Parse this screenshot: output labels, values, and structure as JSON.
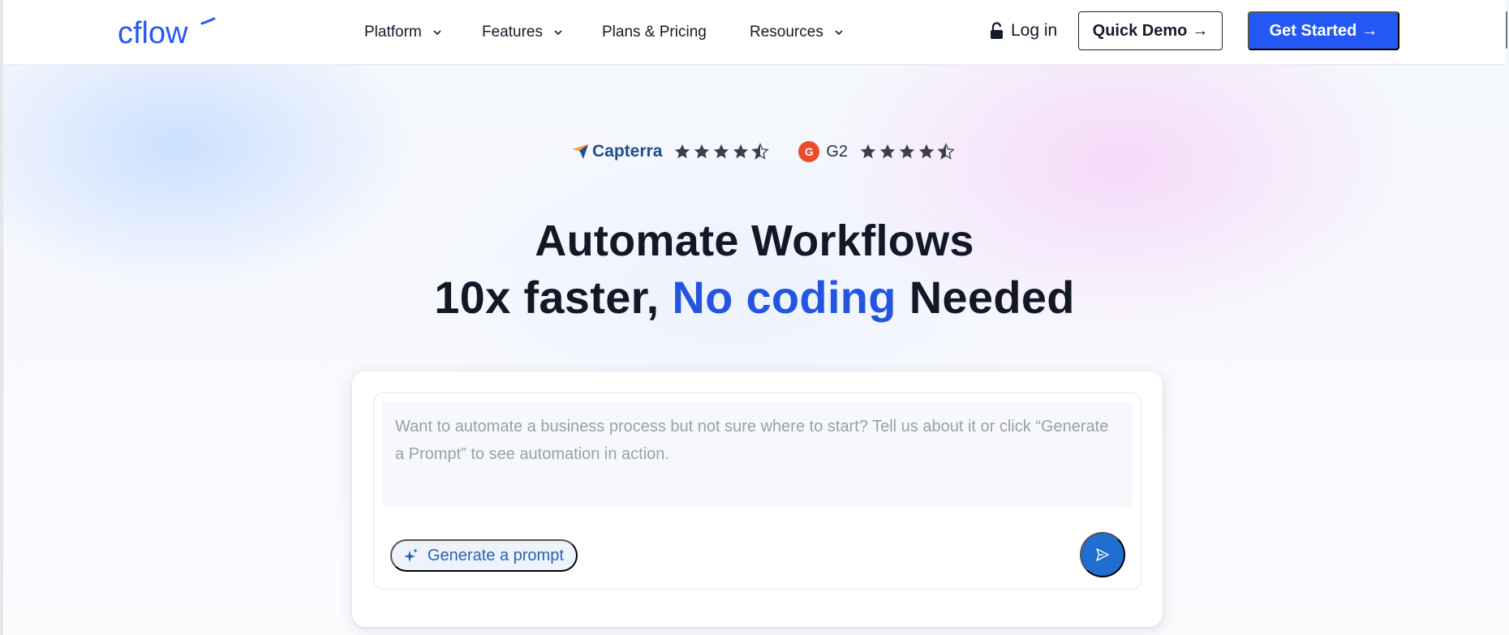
{
  "brand": {
    "logo_text": "cflow"
  },
  "nav": {
    "items": [
      {
        "label": "Platform",
        "has_dropdown": true
      },
      {
        "label": "Features",
        "has_dropdown": true
      },
      {
        "label": "Plans & Pricing",
        "has_dropdown": false
      },
      {
        "label": "Resources",
        "has_dropdown": true
      }
    ],
    "login_label": "Log in",
    "demo_label": "Quick Demo",
    "start_label": "Get Started",
    "arrow": "→"
  },
  "ratings": [
    {
      "source": "Capterra",
      "stars": 4.5
    },
    {
      "source": "G2",
      "stars": 4.5
    }
  ],
  "hero": {
    "line1": "Automate Workflows",
    "line2_before": "10x faster,",
    "line2_accent": "No coding",
    "line2_after": "Needed"
  },
  "prompt": {
    "placeholder": "Want to automate a business process but not sure where to start? Tell us about it or click “Generate a Prompt” to see automation in action.",
    "generate_label": "Generate a prompt"
  },
  "colors": {
    "primary": "#2458f5",
    "accent_text": "#2356e0",
    "send_button": "#1f6fd1",
    "g2_red": "#ef4a2c",
    "capterra_blue": "#1d4f8c"
  },
  "icons": {
    "login": "lock-icon",
    "dropdown": "chevron-down-icon",
    "generate": "sparkle-icon",
    "send": "send-icon",
    "rating": "star-icon"
  }
}
